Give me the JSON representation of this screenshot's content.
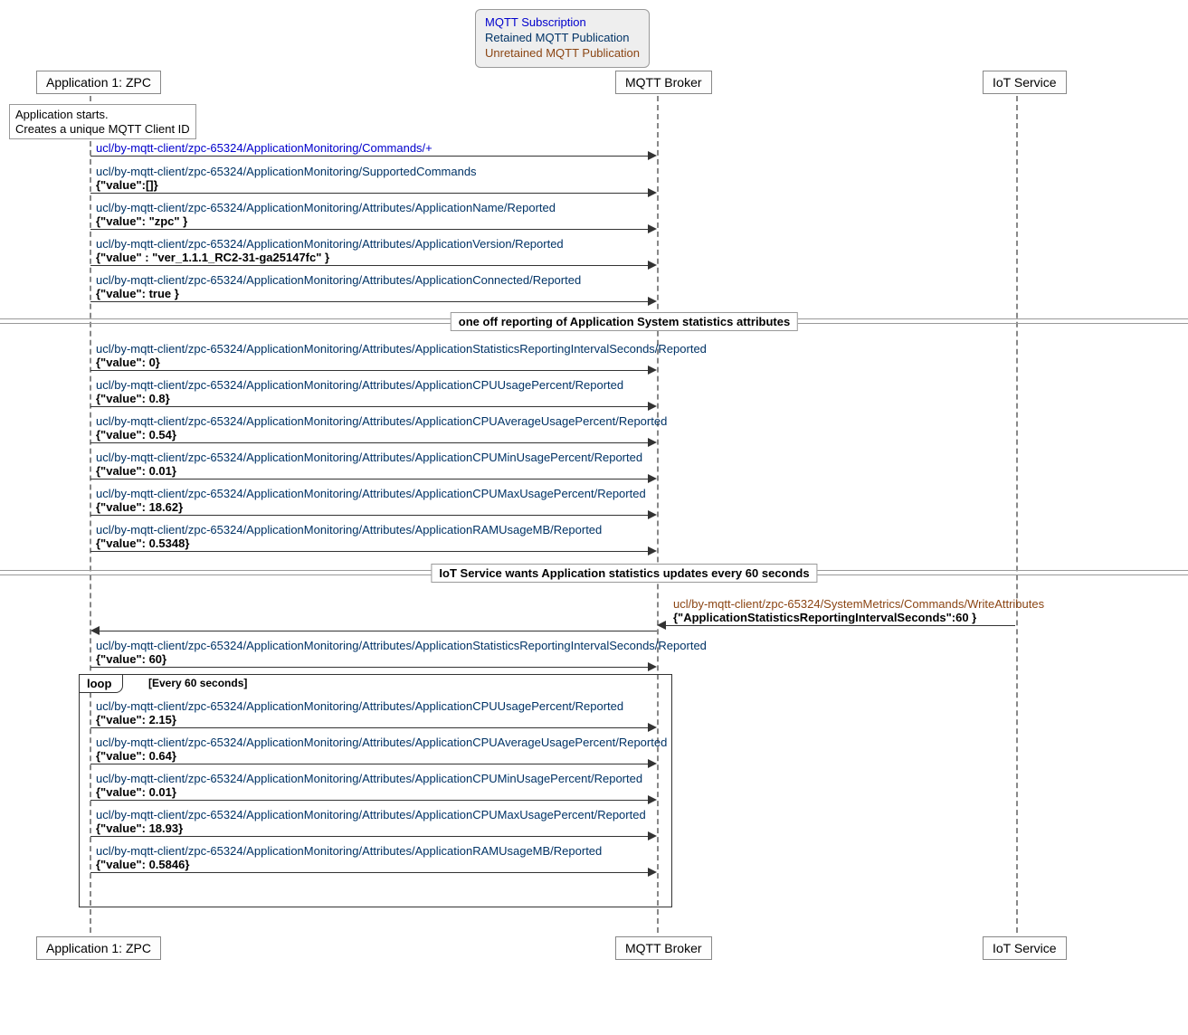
{
  "legend": {
    "subscription": "MQTT Subscription",
    "retained": "Retained MQTT Publication",
    "unretained": "Unretained MQTT Publication"
  },
  "participants": {
    "app": "Application 1: ZPC",
    "broker": "MQTT Broker",
    "iot": "IoT Service"
  },
  "note_start": "Application starts.\nCreates a unique MQTT Client ID",
  "msgs": {
    "m1t": "ucl/by-mqtt-client/zpc-65324/ApplicationMonitoring/Commands/+",
    "m2t": "ucl/by-mqtt-client/zpc-65324/ApplicationMonitoring/SupportedCommands",
    "m2p": "{\"value\":[]}",
    "m3t": "ucl/by-mqtt-client/zpc-65324/ApplicationMonitoring/Attributes/ApplicationName/Reported",
    "m3p": "{\"value\": \"zpc\" }",
    "m4t": "ucl/by-mqtt-client/zpc-65324/ApplicationMonitoring/Attributes/ApplicationVersion/Reported",
    "m4p": "{\"value\" : \"ver_1.1.1_RC2-31-ga25147fc\" }",
    "m5t": "ucl/by-mqtt-client/zpc-65324/ApplicationMonitoring/Attributes/ApplicationConnected/Reported",
    "m5p": "{\"value\": true }",
    "d1": "one off reporting of Application System statistics attributes",
    "m6t": "ucl/by-mqtt-client/zpc-65324/ApplicationMonitoring/Attributes/ApplicationStatisticsReportingIntervalSeconds/Reported",
    "m6p": "{\"value\": 0}",
    "m7t": "ucl/by-mqtt-client/zpc-65324/ApplicationMonitoring/Attributes/ApplicationCPUUsagePercent/Reported",
    "m7p": "{\"value\": 0.8}",
    "m8t": "ucl/by-mqtt-client/zpc-65324/ApplicationMonitoring/Attributes/ApplicationCPUAverageUsagePercent/Reported",
    "m8p": "{\"value\": 0.54}",
    "m9t": "ucl/by-mqtt-client/zpc-65324/ApplicationMonitoring/Attributes/ApplicationCPUMinUsagePercent/Reported",
    "m9p": "{\"value\": 0.01}",
    "m10t": "ucl/by-mqtt-client/zpc-65324/ApplicationMonitoring/Attributes/ApplicationCPUMaxUsagePercent/Reported",
    "m10p": "{\"value\": 18.62}",
    "m11t": "ucl/by-mqtt-client/zpc-65324/ApplicationMonitoring/Attributes/ApplicationRAMUsageMB/Reported",
    "m11p": "{\"value\": 0.5348}",
    "d2": "IoT Service wants Application statistics updates every 60 seconds",
    "m12t": "ucl/by-mqtt-client/zpc-65324/SystemMetrics/Commands/WriteAttributes",
    "m12p": "{\"ApplicationStatisticsReportingIntervalSeconds\":60 }",
    "m13t": "ucl/by-mqtt-client/zpc-65324/ApplicationMonitoring/Attributes/ApplicationStatisticsReportingIntervalSeconds/Reported",
    "m13p": "{\"value\": 60}",
    "loop_label": "loop",
    "loop_cond": "[Every 60 seconds]",
    "m14t": "ucl/by-mqtt-client/zpc-65324/ApplicationMonitoring/Attributes/ApplicationCPUUsagePercent/Reported",
    "m14p": "{\"value\": 2.15}",
    "m15t": "ucl/by-mqtt-client/zpc-65324/ApplicationMonitoring/Attributes/ApplicationCPUAverageUsagePercent/Reported",
    "m15p": "{\"value\": 0.64}",
    "m16t": "ucl/by-mqtt-client/zpc-65324/ApplicationMonitoring/Attributes/ApplicationCPUMinUsagePercent/Reported",
    "m16p": "{\"value\": 0.01}",
    "m17t": "ucl/by-mqtt-client/zpc-65324/ApplicationMonitoring/Attributes/ApplicationCPUMaxUsagePercent/Reported",
    "m17p": "{\"value\": 18.93}",
    "m18t": "ucl/by-mqtt-client/zpc-65324/ApplicationMonitoring/Attributes/ApplicationRAMUsageMB/Reported",
    "m18p": "{\"value\": 0.5846}"
  }
}
